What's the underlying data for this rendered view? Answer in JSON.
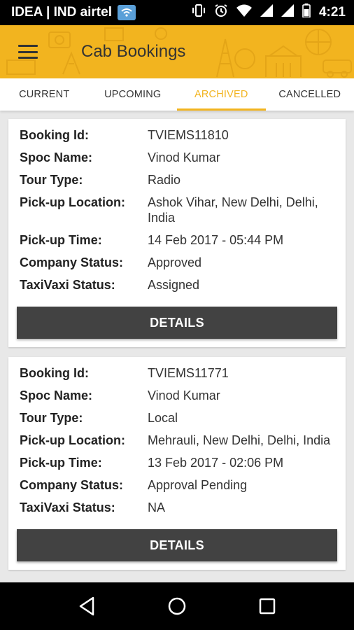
{
  "status_bar": {
    "carrier": "IDEA | IND airtel",
    "time": "4:21",
    "icons": [
      "wifi-calling-icon",
      "vibrate-icon",
      "alarm-icon",
      "wifi-icon",
      "signal-icon",
      "signal-icon",
      "battery-icon"
    ]
  },
  "app_bar": {
    "title": "Cab Bookings",
    "menu_icon": "hamburger-menu-icon",
    "color": "#f2b41f"
  },
  "tabs": [
    {
      "label": "CURRENT",
      "active": false
    },
    {
      "label": "UPCOMING",
      "active": false
    },
    {
      "label": "ARCHIVED",
      "active": true
    },
    {
      "label": "CANCELLED",
      "active": false
    }
  ],
  "labels": {
    "booking_id": "Booking Id:",
    "spoc_name": "Spoc Name:",
    "tour_type": "Tour Type:",
    "pickup_location": "Pick-up Location:",
    "pickup_time": "Pick-up Time:",
    "company_status": "Company Status:",
    "taxivaxi_status": "TaxiVaxi Status:",
    "details_button": "DETAILS"
  },
  "bookings": [
    {
      "booking_id": "TVIEMS11810",
      "spoc_name": "Vinod Kumar",
      "tour_type": "Radio",
      "pickup_location": "Ashok Vihar, New Delhi, Delhi, India",
      "pickup_time": "14 Feb 2017 - 05:44 PM",
      "company_status": "Approved",
      "taxivaxi_status": "Assigned"
    },
    {
      "booking_id": "TVIEMS11771",
      "spoc_name": "Vinod Kumar",
      "tour_type": "Local",
      "pickup_location": "Mehrauli, New Delhi, Delhi, India",
      "pickup_time": "13 Feb 2017 - 02:06 PM",
      "company_status": "Approval Pending",
      "taxivaxi_status": "NA"
    }
  ],
  "nav_bar": {
    "icons": [
      "back-icon",
      "home-icon",
      "recents-icon"
    ]
  }
}
